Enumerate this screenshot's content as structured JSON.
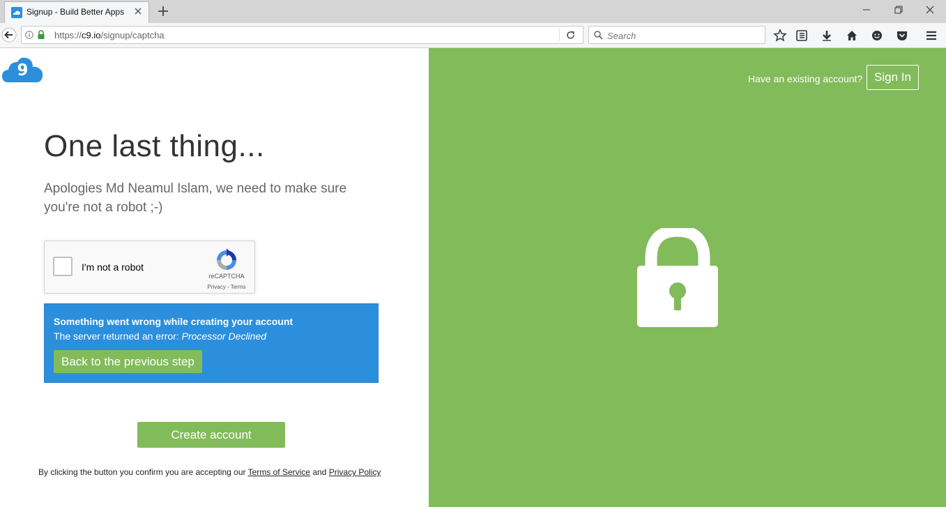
{
  "browser": {
    "tab_title": "Signup - Build Better Apps",
    "url_prefix": "https://",
    "url_host": "c9.io",
    "url_path": "/signup/captcha",
    "search_placeholder": "Search"
  },
  "header": {
    "existing_account_text": "Have an existing account?",
    "sign_in_label": "Sign In"
  },
  "main": {
    "heading": "One last thing...",
    "subtitle": "Apologies Md Neamul Islam, we need to make sure you're not a robot ;-)"
  },
  "recaptcha": {
    "label": "I'm not a robot",
    "brand": "reCAPTCHA",
    "links": "Privacy - Terms"
  },
  "error": {
    "title": "Something went wrong while creating your account",
    "message_prefix": "The server returned an error:",
    "message_detail": "Processor Declined",
    "back_label": "Back to the previous step"
  },
  "actions": {
    "create_account_label": "Create account"
  },
  "terms": {
    "prefix": "By clicking the button you confirm you are accepting our",
    "tos_label": "Terms of Service",
    "and": "and",
    "privacy_label": "Privacy Policy"
  },
  "colors": {
    "brand_green": "#82bb5a",
    "error_blue": "#2b8fdd",
    "logo_blue": "#2b8fdd"
  }
}
